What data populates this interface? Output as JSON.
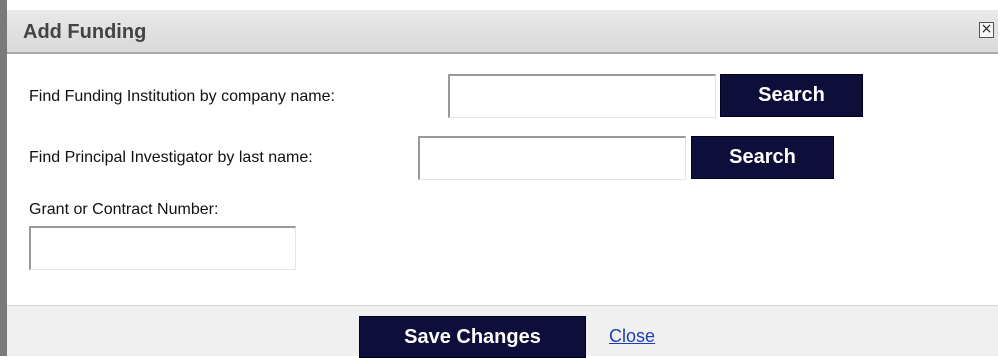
{
  "dialog": {
    "title": "Add Funding",
    "close_icon": "close-icon"
  },
  "funding_institution": {
    "label": "Find Funding Institution by company name:",
    "value": "",
    "button_label": "Search"
  },
  "principal_investigator": {
    "label": "Find Principal Investigator by last name:",
    "value": "",
    "button_label": "Search"
  },
  "grant_number": {
    "label": "Grant or Contract Number:",
    "value": ""
  },
  "footer": {
    "save_label": "Save Changes",
    "close_label": "Close"
  },
  "colors": {
    "button_bg": "#0e0e3a",
    "link": "#1a3fb4",
    "title_text": "#444444"
  }
}
